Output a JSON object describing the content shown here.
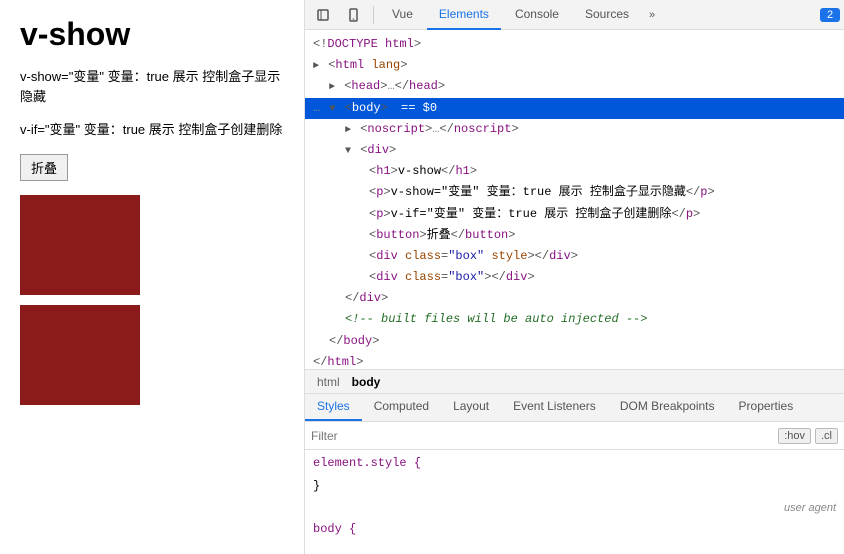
{
  "leftPanel": {
    "title": "v-show",
    "para1": "v-show=\"变量\" 变量：true 展示 控制盒子显示隐藏",
    "para2": "v-if=\"变量\" 变量：true 展示 控制盒子创建删除",
    "button_label": "折叠"
  },
  "devtools": {
    "tabs": [
      "Vue",
      "Elements",
      "Console",
      "Sources",
      "»"
    ],
    "active_tab": "Elements",
    "badge": "2",
    "html_lines": [
      {
        "indent": 0,
        "content": "<!DOCTYPE html>",
        "type": "doctype"
      },
      {
        "indent": 0,
        "content": "<html lang>",
        "type": "tag_open",
        "triangle": "right"
      },
      {
        "indent": 1,
        "content": "<head>…</head>",
        "type": "collapsed",
        "triangle": "right"
      },
      {
        "indent": 0,
        "content": "▼ <body> == $0",
        "type": "selected",
        "triangle": "down"
      },
      {
        "indent": 2,
        "content": "<noscript>…</noscript>",
        "type": "collapsed",
        "triangle": "right"
      },
      {
        "indent": 2,
        "content": "<div>",
        "type": "tag_open",
        "triangle": "down"
      },
      {
        "indent": 3,
        "content": "<h1>v-show</h1>",
        "type": "inline"
      },
      {
        "indent": 3,
        "content": "<p>v-show=\"变量\" 变量：true 展示 控制盒子显示隐藏</p>",
        "type": "inline"
      },
      {
        "indent": 3,
        "content": "<p>v-if=\"变量\" 变量：true 展示 控制盒子创建删除</p>",
        "type": "inline"
      },
      {
        "indent": 3,
        "content": "<button>折叠</button>",
        "type": "inline"
      },
      {
        "indent": 3,
        "content": "<div class=\"box\" style></div>",
        "type": "inline"
      },
      {
        "indent": 3,
        "content": "<div class=\"box\"></div>",
        "type": "inline"
      },
      {
        "indent": 2,
        "content": "</div>",
        "type": "tag_close"
      },
      {
        "indent": 2,
        "content": "<!-- built files will be auto injected -->",
        "type": "comment"
      },
      {
        "indent": 1,
        "content": "</body>",
        "type": "tag_close"
      },
      {
        "indent": 0,
        "content": "</html>",
        "type": "tag_close"
      }
    ],
    "breadcrumbs": [
      "html",
      "body"
    ],
    "active_breadcrumb": "body",
    "style_tabs": [
      "Styles",
      "Computed",
      "Layout",
      "Event Listeners",
      "DOM Breakpoints",
      "Properties"
    ],
    "active_style_tab": "Styles",
    "filter_placeholder": "Filter",
    "filter_btn1": ":hov",
    "filter_btn2": ".cl",
    "css_rule1_selector": "element.style {",
    "css_rule1_close": "}",
    "css_rule2_selector": "body {",
    "user_agent_label": "user agent"
  }
}
